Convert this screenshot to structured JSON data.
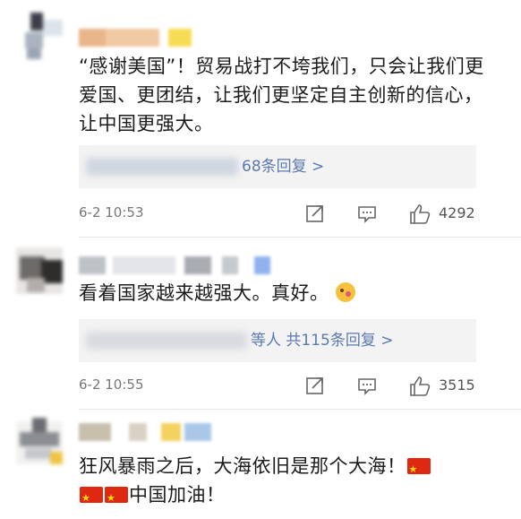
{
  "comments": [
    {
      "content": "“感谢美国”！贸易战打不垮我们，只会让我们更爱国、更团结，让我们更坚定自主创新的信心，让中国更强大。",
      "reply_link": "68条回复 >",
      "time": "6-2 10:53",
      "likes": "4292"
    },
    {
      "content": "看着国家越来越强大。真好。",
      "reply_link": "等人 共115条回复 >",
      "time": "6-2 10:55",
      "likes": "3515"
    },
    {
      "content_line1": "狂风暴雨之后，大海依旧是那个大海！",
      "content_line2": "中国加油！"
    }
  ],
  "icons": {
    "share": "share-icon",
    "comment": "comment-icon",
    "like": "thumbs-up-icon",
    "flag": "china-flag-icon",
    "emoji": "smiling-face-icon"
  },
  "colors": {
    "link": "#5b7ab3",
    "text": "#1c1c1c",
    "meta": "#777777",
    "reply_bg": "#f3f3f3"
  }
}
